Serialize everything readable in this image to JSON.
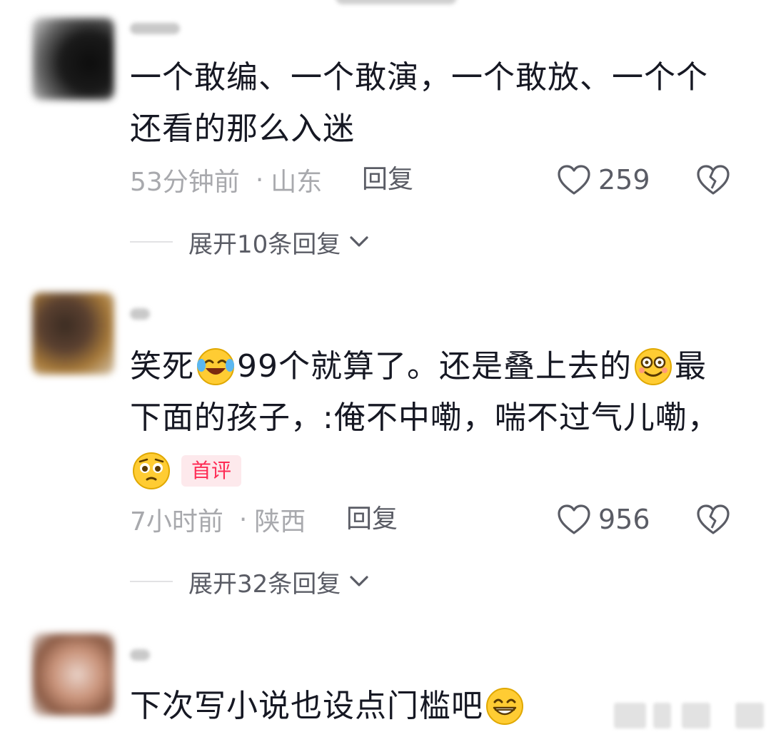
{
  "comments": [
    {
      "text_lines": [
        "一个敢编、一个敢演，一个敢放、一个个",
        "还看的那么入迷"
      ],
      "time": "53分钟前",
      "location": "山东",
      "reply_label": "回复",
      "likes": "259",
      "expand_label": "展开10条回复"
    },
    {
      "text_line1_a": "笑死",
      "text_line1_b": "99个就算了。还是叠上去的",
      "text_line1_c": "最",
      "text_line2": "下面的孩子，:俺不中嘞，喘不过气儿嘞，",
      "badge": "首评",
      "time": "7小时前",
      "location": "陕西",
      "reply_label": "回复",
      "likes": "956",
      "expand_label": "展开32条回复",
      "emojis": [
        "laugh-cry-emoji",
        "dizzy-smile-emoji",
        "pleading-emoji"
      ]
    },
    {
      "text": "下次写小说也设点门槛吧",
      "emojis": [
        "grin-emoji"
      ]
    }
  ],
  "colors": {
    "text": "#161823",
    "meta": "#a8a9ad",
    "action": "#5a5c65",
    "badge_text": "#fe2c55",
    "badge_bg": "#fde9ec"
  },
  "icons": [
    "heart-icon",
    "broken-heart-icon",
    "chevron-down-icon"
  ]
}
